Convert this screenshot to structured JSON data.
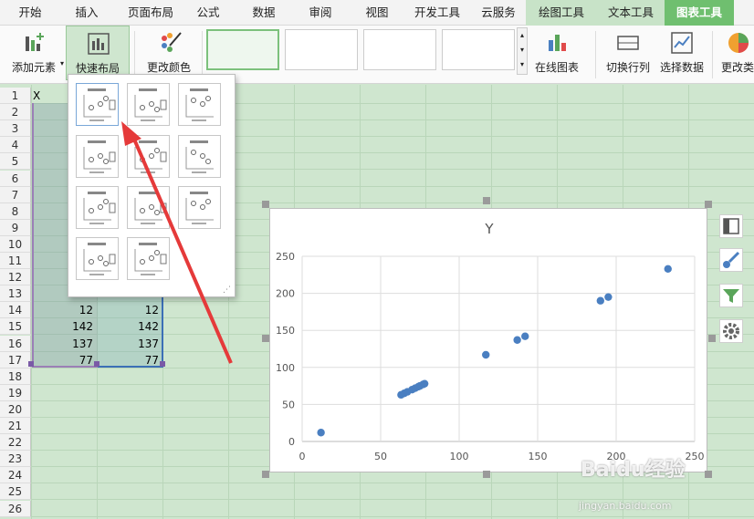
{
  "tabs": [
    "开始",
    "插入",
    "页面布局",
    "公式",
    "数据",
    "审阅",
    "视图",
    "开发工具",
    "云服务",
    "绘图工具",
    "文本工具",
    "图表工具"
  ],
  "ribbon": {
    "add_element": "添加元素",
    "quick_layout": "快速布局",
    "change_color": "更改颜色",
    "online_chart": "在线图表",
    "switch_row_col": "切换行列",
    "select_data": "选择数据",
    "change_type": "更改类"
  },
  "sheet": {
    "row_numbers": [
      "1",
      "2",
      "3",
      "4",
      "5",
      "6",
      "7",
      "8",
      "9",
      "10",
      "11",
      "12",
      "13",
      "14",
      "15",
      "16",
      "17",
      "18",
      "19",
      "20",
      "21",
      "22",
      "23",
      "24",
      "25",
      "26"
    ],
    "header_cell": "X",
    "visible_values": [
      {
        "row": "14",
        "a": "12",
        "b": "12"
      },
      {
        "row": "15",
        "a": "142",
        "b": "142"
      },
      {
        "row": "16",
        "a": "137",
        "b": "137"
      },
      {
        "row": "17",
        "a": "77",
        "b": "77"
      }
    ]
  },
  "icons": {
    "side1": "chart-elements-icon",
    "side2": "chart-style-brush-icon",
    "side3": "chart-filter-icon",
    "side4": "chart-settings-gear-icon"
  },
  "chart_data": {
    "type": "scatter",
    "title": "Y",
    "xlabel": "",
    "ylabel": "",
    "xlim": [
      0,
      250
    ],
    "ylim": [
      0,
      250
    ],
    "xticks": [
      "0",
      "50",
      "100",
      "150",
      "200",
      "250"
    ],
    "yticks": [
      "0",
      "50",
      "100",
      "150",
      "200",
      "250"
    ],
    "grid": true,
    "color": "#4a7fc1",
    "points": [
      [
        12,
        12
      ],
      [
        63,
        63
      ],
      [
        65,
        65
      ],
      [
        67,
        67
      ],
      [
        70,
        70
      ],
      [
        72,
        72
      ],
      [
        74,
        74
      ],
      [
        75,
        75
      ],
      [
        77,
        77
      ],
      [
        78,
        78
      ],
      [
        117,
        117
      ],
      [
        137,
        137
      ],
      [
        142,
        142
      ],
      [
        190,
        190
      ],
      [
        195,
        195
      ],
      [
        233,
        233
      ]
    ]
  },
  "watermark": {
    "brand": "Baidu经验",
    "url": "jingyan.baidu.com"
  }
}
